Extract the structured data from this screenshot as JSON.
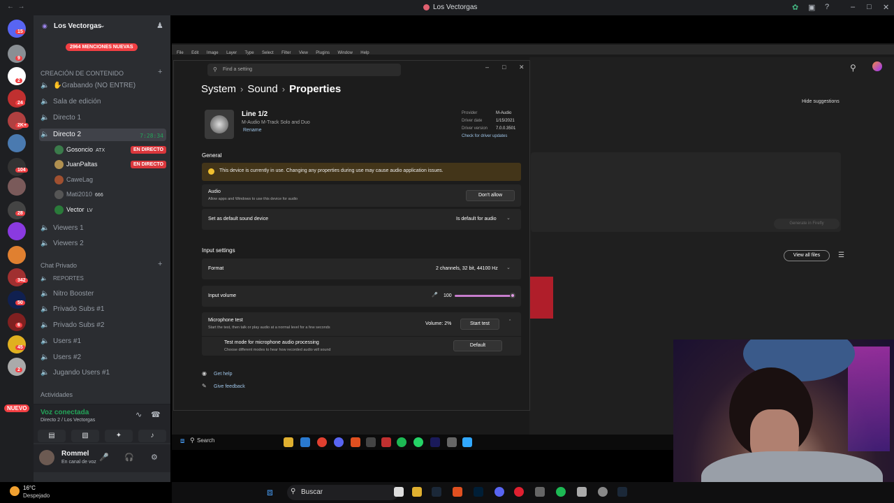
{
  "discord": {
    "window_title": "Los Vectorgas",
    "guild_name": "Los Vectorgas",
    "mentions_banner": "2964 MENCIONES NUEVAS",
    "server_badges": [
      "15",
      "9",
      "2",
      "24",
      "2K+",
      "104",
      "28",
      "342",
      "50",
      "6",
      "45",
      "2"
    ],
    "nuevo_label": "NUEVO",
    "categories": [
      {
        "label": "CREACIÓN DE CONTENIDO"
      },
      {
        "label": "Chat Privado"
      },
      {
        "label": "Actividades"
      }
    ],
    "channels_content": [
      {
        "label": "✋Grabando (NO ENTRE)"
      },
      {
        "label": "Sala de edición"
      },
      {
        "label": "Directo 1"
      },
      {
        "label": "Directo 2",
        "timer": "7:28:34"
      }
    ],
    "voice_users": [
      {
        "name": "Gosoncio",
        "tag": "ATX",
        "live": "EN DIRECTO"
      },
      {
        "name": "JuanPaltas",
        "tag": "",
        "live": "EN DIRECTO"
      },
      {
        "name": "CaweLag",
        "tag": "",
        "live": ""
      },
      {
        "name": "Mati2010",
        "tag": "666",
        "live": ""
      },
      {
        "name": "Vector",
        "tag": "LV",
        "live": ""
      }
    ],
    "channels_more": [
      {
        "label": "Viewers 1"
      },
      {
        "label": "Viewers 2"
      }
    ],
    "channels_private": [
      {
        "label": "REPORTES"
      },
      {
        "label": "Nitro Booster"
      },
      {
        "label": "Privado Subs #1"
      },
      {
        "label": "Privado Subs #2"
      },
      {
        "label": "Users #1"
      },
      {
        "label": "Users #2"
      },
      {
        "label": "Jugando Users #1"
      }
    ],
    "voice_status": "Voz conectada",
    "voice_channel": "Directo 2 / Los Vectorgas",
    "user_name": "Rommel",
    "user_status": "En canal de voz"
  },
  "weather": {
    "temp": "16°C",
    "desc": "Despejado"
  },
  "taskbar": {
    "search_label": "Buscar"
  },
  "photoshop": {
    "menu": [
      "File",
      "Edit",
      "Image",
      "Layer",
      "Type",
      "Select",
      "Filter",
      "View",
      "Plugins",
      "Window",
      "Help"
    ],
    "hide_suggestions": "Hide suggestions",
    "generate_label": "Generate in Firefly",
    "view_all_files": "View all files",
    "taskbar_search": "Search"
  },
  "settings": {
    "search_placeholder": "Find a setting",
    "breadcrumb": [
      "System",
      "Sound",
      "Properties"
    ],
    "device_name": "Line 1/2",
    "device_sub": "M-Audio M-Track Solo and Duo",
    "rename": "Rename",
    "driver": {
      "provider_label": "Provider",
      "provider": "M-Audio",
      "date_label": "Driver date",
      "date": "1/15/2021",
      "version_label": "Driver version",
      "version": "7.0.0.3501",
      "updates_link": "Check for driver updates"
    },
    "general_title": "General",
    "warning": "This device is currently in use. Changing any properties during use may cause audio application issues.",
    "audio_label": "Audio",
    "audio_sub": "Allow apps and Windows to use this device for audio",
    "dont_allow": "Don't allow",
    "default_label": "Set as default sound device",
    "default_value": "Is default for audio",
    "input_title": "Input settings",
    "format_label": "Format",
    "format_value": "2 channels, 32 bit, 44100 Hz",
    "volume_label": "Input volume",
    "volume_value": "100",
    "volume_level": 1.0,
    "mic_test_label": "Microphone test",
    "mic_test_sub": "Start the test, then talk or play audio at a normal level for a few seconds",
    "mic_volume": "Volume: 2%",
    "start_test": "Start test",
    "test_mode_label": "Test mode for microphone audio processing",
    "test_mode_sub": "Choose different modes to hear how recorded audio will sound",
    "test_mode_value": "Default",
    "get_help": "Get help",
    "feedback": "Give feedback"
  },
  "colors": {
    "live_red": "#da373c",
    "voice_green": "#23a559",
    "accent_pink": "#c77dcc"
  }
}
